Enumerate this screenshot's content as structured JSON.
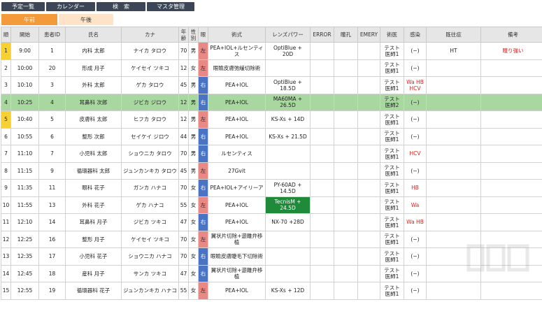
{
  "nav": [
    "予定一覧",
    "カレンダー",
    "検　索",
    "マスタ管理"
  ],
  "tabs": [
    "午前",
    "午後"
  ],
  "headers": [
    "順",
    "開始",
    "患者ID",
    "氏名",
    "カナ",
    "年齢",
    "性別",
    "眼",
    "術式",
    "レンズパワー",
    "ERROR",
    "瞳孔",
    "EMERY",
    "術医",
    "感染",
    "既往症",
    "備考"
  ],
  "rows": [
    {
      "no": "1",
      "time": "9:00",
      "pid": "1",
      "name": "内科 太郎",
      "kana": "ナイカ タロウ",
      "age": "70",
      "sex": "男",
      "eye": "左",
      "op": "PEA+IOL+ルセンティス",
      "lens": "OptiBlue +\n20D",
      "error": "",
      "pupil": "",
      "emery": "",
      "doctor": "テスト\n医師1",
      "infect": "(−)",
      "history": "HT",
      "note": "瞳り強い",
      "idx_flag": true,
      "hl": false,
      "lens_hl": false,
      "infect_red": false
    },
    {
      "no": "2",
      "time": "10:00",
      "pid": "20",
      "name": "形成 月子",
      "kana": "ケイセイ ツキコ",
      "age": "12",
      "sex": "女",
      "eye": "左",
      "op": "眼瞼皮膚弛緩切除術",
      "lens": "",
      "error": "",
      "pupil": "",
      "emery": "",
      "doctor": "テスト\n医師1",
      "infect": "(−)",
      "history": "",
      "note": "",
      "idx_flag": false,
      "hl": false,
      "lens_hl": false,
      "infect_red": false
    },
    {
      "no": "3",
      "time": "10:10",
      "pid": "3",
      "name": "外科 太郎",
      "kana": "ゲカ タロウ",
      "age": "45",
      "sex": "男",
      "eye": "右",
      "op": "PEA+IOL",
      "lens": "OptiBlue +\n18.5D",
      "error": "",
      "pupil": "",
      "emery": "",
      "doctor": "テスト\n医師1",
      "infect": "Wa HB\nHCV",
      "history": "",
      "note": "",
      "idx_flag": false,
      "hl": false,
      "lens_hl": false,
      "infect_red": true
    },
    {
      "no": "4",
      "time": "10:25",
      "pid": "4",
      "name": "耳鼻科 次郎",
      "kana": "ジビカ ジロウ",
      "age": "12",
      "sex": "男",
      "eye": "右",
      "op": "PEA+IOL",
      "lens": "MA60MA +\n26.5D",
      "error": "",
      "pupil": "",
      "emery": "",
      "doctor": "テスト\n医師2",
      "infect": "(−)",
      "history": "",
      "note": "",
      "idx_flag": false,
      "hl": true,
      "lens_hl": false,
      "infect_red": false
    },
    {
      "no": "5",
      "time": "10:40",
      "pid": "5",
      "name": "皮膚科 太郎",
      "kana": "ヒフカ タロウ",
      "age": "12",
      "sex": "男",
      "eye": "左",
      "op": "PEA+IOL",
      "lens": "KS-Xs + 14D",
      "error": "",
      "pupil": "",
      "emery": "",
      "doctor": "テスト\n医師1",
      "infect": "(−)",
      "history": "",
      "note": "",
      "idx_flag": true,
      "hl": false,
      "lens_hl": false,
      "infect_red": false
    },
    {
      "no": "6",
      "time": "10:55",
      "pid": "6",
      "name": "整形 次郎",
      "kana": "セイケイ ジロウ",
      "age": "44",
      "sex": "男",
      "eye": "右",
      "op": "PEA+IOL",
      "lens": "KS-Xs + 21.5D",
      "error": "",
      "pupil": "",
      "emery": "",
      "doctor": "テスト\n医師1",
      "infect": "(−)",
      "history": "",
      "note": "",
      "idx_flag": false,
      "hl": false,
      "lens_hl": false,
      "infect_red": false
    },
    {
      "no": "7",
      "time": "11:10",
      "pid": "7",
      "name": "小児科 太郎",
      "kana": "ショウニカ タロウ",
      "age": "70",
      "sex": "男",
      "eye": "右",
      "op": "ルセンティス",
      "lens": "",
      "error": "",
      "pupil": "",
      "emery": "",
      "doctor": "テスト\n医師1",
      "infect": "HCV",
      "history": "",
      "note": "",
      "idx_flag": false,
      "hl": false,
      "lens_hl": false,
      "infect_red": true
    },
    {
      "no": "8",
      "time": "11:15",
      "pid": "9",
      "name": "循環器科 太郎",
      "kana": "ジュンカンキカ タロウ",
      "age": "45",
      "sex": "男",
      "eye": "左",
      "op": "27Gvit",
      "lens": "",
      "error": "",
      "pupil": "",
      "emery": "",
      "doctor": "テスト\n医師1",
      "infect": "(−)",
      "history": "",
      "note": "",
      "idx_flag": false,
      "hl": false,
      "lens_hl": false,
      "infect_red": false
    },
    {
      "no": "9",
      "time": "11:35",
      "pid": "11",
      "name": "眼科 花子",
      "kana": "ガンカ ハナコ",
      "age": "70",
      "sex": "女",
      "eye": "右",
      "op": "PEA+IOL+アイリーア",
      "lens": "PY-60AD +\n14.5D",
      "error": "",
      "pupil": "",
      "emery": "",
      "doctor": "テスト\n医師1",
      "infect": "HB",
      "history": "",
      "note": "",
      "idx_flag": false,
      "hl": false,
      "lens_hl": false,
      "infect_red": true
    },
    {
      "no": "10",
      "time": "11:55",
      "pid": "13",
      "name": "外科 花子",
      "kana": "ゲカ ハナコ",
      "age": "55",
      "sex": "女",
      "eye": "左",
      "op": "PEA+IOL",
      "lens": "TecnisM +\n24.5D",
      "error": "",
      "pupil": "",
      "emery": "",
      "doctor": "テスト\n医師1",
      "infect": "Wa",
      "history": "",
      "note": "",
      "idx_flag": false,
      "hl": false,
      "lens_hl": true,
      "infect_red": true
    },
    {
      "no": "11",
      "time": "12:10",
      "pid": "14",
      "name": "耳鼻科 月子",
      "kana": "ジビカ ツキコ",
      "age": "47",
      "sex": "女",
      "eye": "右",
      "op": "PEA+IOL",
      "lens": "NX-70 +28D",
      "error": "",
      "pupil": "",
      "emery": "",
      "doctor": "テスト\n医師1",
      "infect": "Wa HB",
      "history": "",
      "note": "",
      "idx_flag": false,
      "hl": false,
      "lens_hl": false,
      "infect_red": true
    },
    {
      "no": "12",
      "time": "12:25",
      "pid": "16",
      "name": "整形 月子",
      "kana": "ケイセイ ツキコ",
      "age": "70",
      "sex": "女",
      "eye": "左",
      "op": "翼状片切除+遊離弁移植",
      "lens": "",
      "error": "",
      "pupil": "",
      "emery": "",
      "doctor": "テスト\n医師1",
      "infect": "(−)",
      "history": "",
      "note": "",
      "idx_flag": false,
      "hl": false,
      "lens_hl": false,
      "infect_red": false
    },
    {
      "no": "13",
      "time": "12:35",
      "pid": "17",
      "name": "小児科 花子",
      "kana": "ショウニカ ハナコ",
      "age": "70",
      "sex": "女",
      "eye": "右",
      "op": "眼瞼皮膚睫毛下切除術",
      "lens": "",
      "error": "",
      "pupil": "",
      "emery": "",
      "doctor": "テスト\n医師1",
      "infect": "(−)",
      "history": "",
      "note": "",
      "idx_flag": false,
      "hl": false,
      "lens_hl": false,
      "infect_red": false
    },
    {
      "no": "14",
      "time": "12:45",
      "pid": "18",
      "name": "産科 月子",
      "kana": "サンカ ツキコ",
      "age": "47",
      "sex": "女",
      "eye": "右",
      "op": "翼状片切除+遊離弁移植",
      "lens": "",
      "error": "",
      "pupil": "",
      "emery": "",
      "doctor": "テスト\n医師1",
      "infect": "(−)",
      "history": "",
      "note": "",
      "idx_flag": false,
      "hl": false,
      "lens_hl": false,
      "infect_red": false
    },
    {
      "no": "15",
      "time": "12:55",
      "pid": "19",
      "name": "循環器科 花子",
      "kana": "ジュンカンキカ ハナコ",
      "age": "55",
      "sex": "女",
      "eye": "左",
      "op": "PEA+IOL",
      "lens": "KS-Xs + 12D",
      "error": "",
      "pupil": "",
      "emery": "",
      "doctor": "テスト\n医師1",
      "infect": "(−)",
      "history": "",
      "note": "",
      "idx_flag": false,
      "hl": false,
      "lens_hl": false,
      "infect_red": false
    }
  ]
}
